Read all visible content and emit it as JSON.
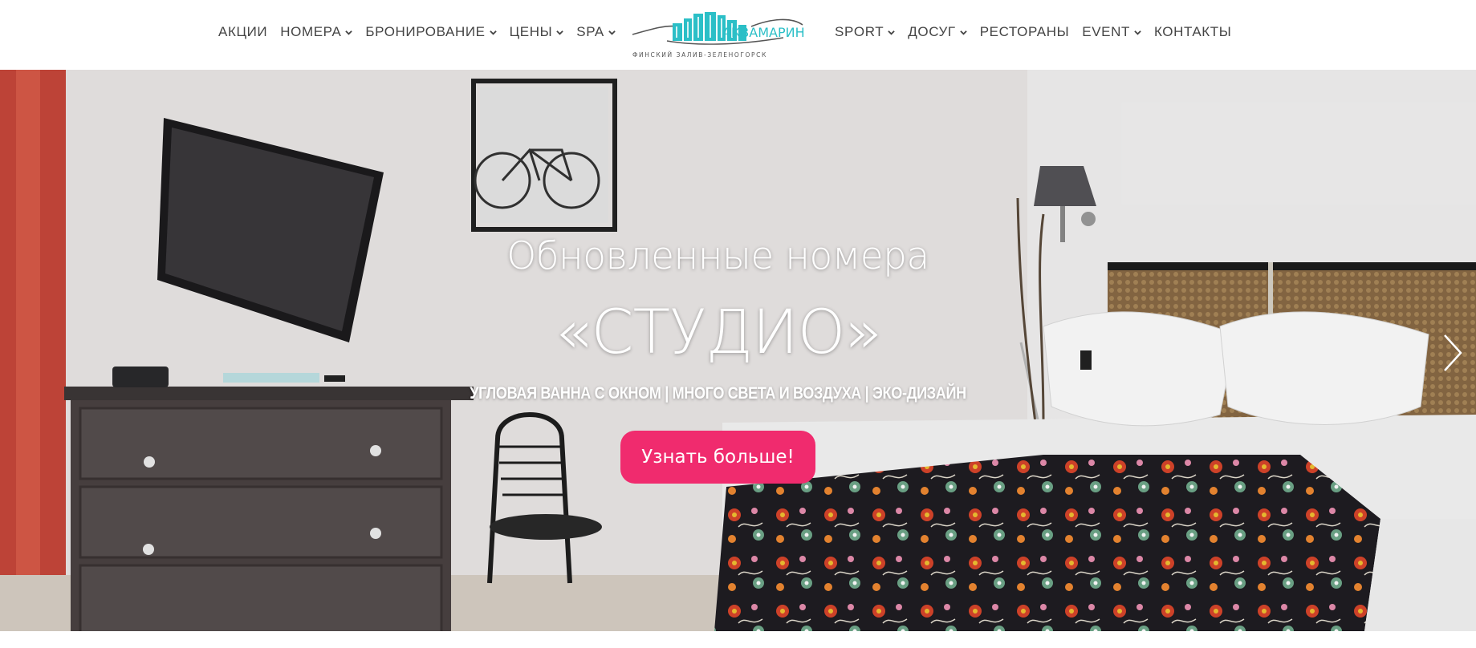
{
  "nav_left": [
    {
      "label": "АКЦИИ",
      "has_dropdown": false
    },
    {
      "label": "НОМЕРА",
      "has_dropdown": true
    },
    {
      "label": "БРОНИРОВАНИЕ",
      "has_dropdown": true
    },
    {
      "label": "ЦЕНЫ",
      "has_dropdown": true
    },
    {
      "label": "SPA",
      "has_dropdown": true
    }
  ],
  "nav_right": [
    {
      "label": "SPORT",
      "has_dropdown": true
    },
    {
      "label": "ДОСУГ",
      "has_dropdown": true
    },
    {
      "label": "РЕСТОРАНЫ",
      "has_dropdown": false
    },
    {
      "label": "EVENT",
      "has_dropdown": true
    },
    {
      "label": "КОНТАКТЫ",
      "has_dropdown": false
    }
  ],
  "logo": {
    "name": "АКВАМАРИН",
    "tagline": "ФИНСКИЙ ЗАЛИВ-ЗЕЛЕНОГОРСК",
    "color": "#2bbfc7"
  },
  "hero": {
    "title": "Обновленные номера",
    "title_main": "«СТУДИО»",
    "subtitle": "УГЛОВАЯ ВАННА С ОКНОМ | МНОГО СВЕТА И ВОЗДУХА | ЭКО-ДИЗАЙН",
    "cta_label": "Узнать больше!",
    "cta_color": "#f02b6e",
    "next_icon": "chevron-right-icon"
  }
}
